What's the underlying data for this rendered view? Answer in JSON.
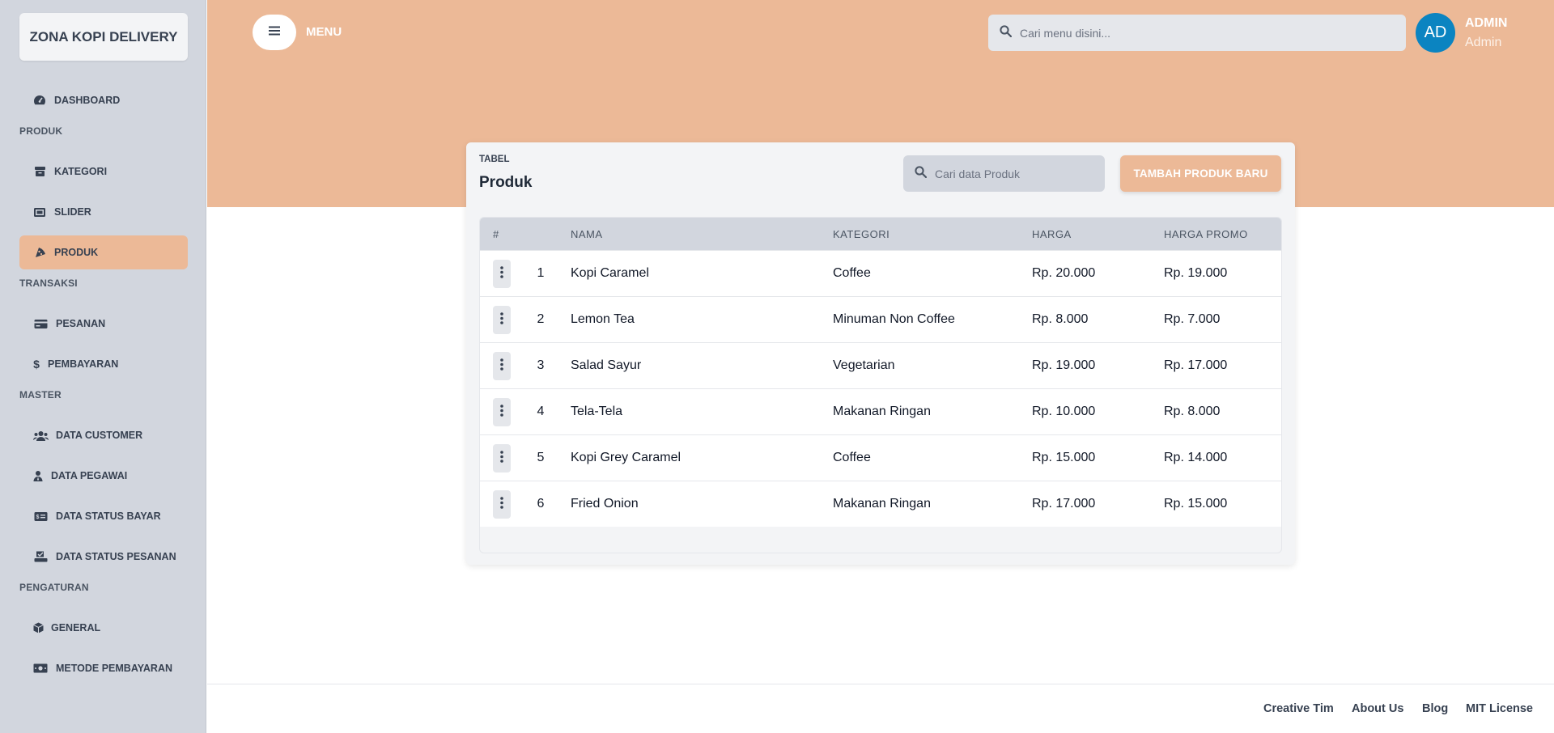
{
  "brand": "ZONA KOPI DELIVERY",
  "sidebar": {
    "dashboard": "DASHBOARD",
    "section_produk": "PRODUK",
    "kategori": "KATEGORI",
    "slider": "SLIDER",
    "produk": "PRODUK",
    "section_transaksi": "TRANSAKSI",
    "pesanan": "PESANAN",
    "pembayaran": "PEMBAYARAN",
    "section_master": "MASTER",
    "data_customer": "DATA CUSTOMER",
    "data_pegawai": "DATA PEGAWAI",
    "data_status_bayar": "DATA STATUS BAYAR",
    "data_status_pesanan": "DATA STATUS PESANAN",
    "section_pengaturan": "PENGATURAN",
    "general": "GENERAL",
    "metode_pembayaran": "METODE PEMBAYARAN"
  },
  "header": {
    "menu_label": "MENU",
    "search_placeholder": "Cari menu disini...",
    "avatar_initials": "AD",
    "user_name": "ADMIN",
    "user_role": "Admin"
  },
  "card": {
    "subtitle": "TABEL",
    "title": "Produk",
    "search_placeholder": "Cari data Produk",
    "add_button": "TAMBAH PRODUK BARU"
  },
  "table": {
    "headers": [
      "#",
      "NAMA",
      "KATEGORI",
      "HARGA",
      "HARGA PROMO"
    ],
    "rows": [
      {
        "no": "1",
        "nama": "Kopi Caramel",
        "kategori": "Coffee",
        "harga": "Rp. 20.000",
        "promo": "Rp. 19.000"
      },
      {
        "no": "2",
        "nama": "Lemon Tea",
        "kategori": "Minuman Non Coffee",
        "harga": "Rp. 8.000",
        "promo": "Rp. 7.000"
      },
      {
        "no": "3",
        "nama": "Salad Sayur",
        "kategori": "Vegetarian",
        "harga": "Rp. 19.000",
        "promo": "Rp. 17.000"
      },
      {
        "no": "4",
        "nama": "Tela-Tela",
        "kategori": "Makanan Ringan",
        "harga": "Rp. 10.000",
        "promo": "Rp. 8.000"
      },
      {
        "no": "5",
        "nama": "Kopi Grey Caramel",
        "kategori": "Coffee",
        "harga": "Rp. 15.000",
        "promo": "Rp. 14.000"
      },
      {
        "no": "6",
        "nama": "Fried Onion",
        "kategori": "Makanan Ringan",
        "harga": "Rp. 17.000",
        "promo": "Rp. 15.000"
      }
    ]
  },
  "footer": {
    "links": [
      "Creative Tim",
      "About Us",
      "Blog",
      "MIT License"
    ]
  },
  "colors": {
    "accent": "#ecb997",
    "sidebar_bg": "#d2d6de",
    "avatar_bg": "#0b84c1"
  }
}
